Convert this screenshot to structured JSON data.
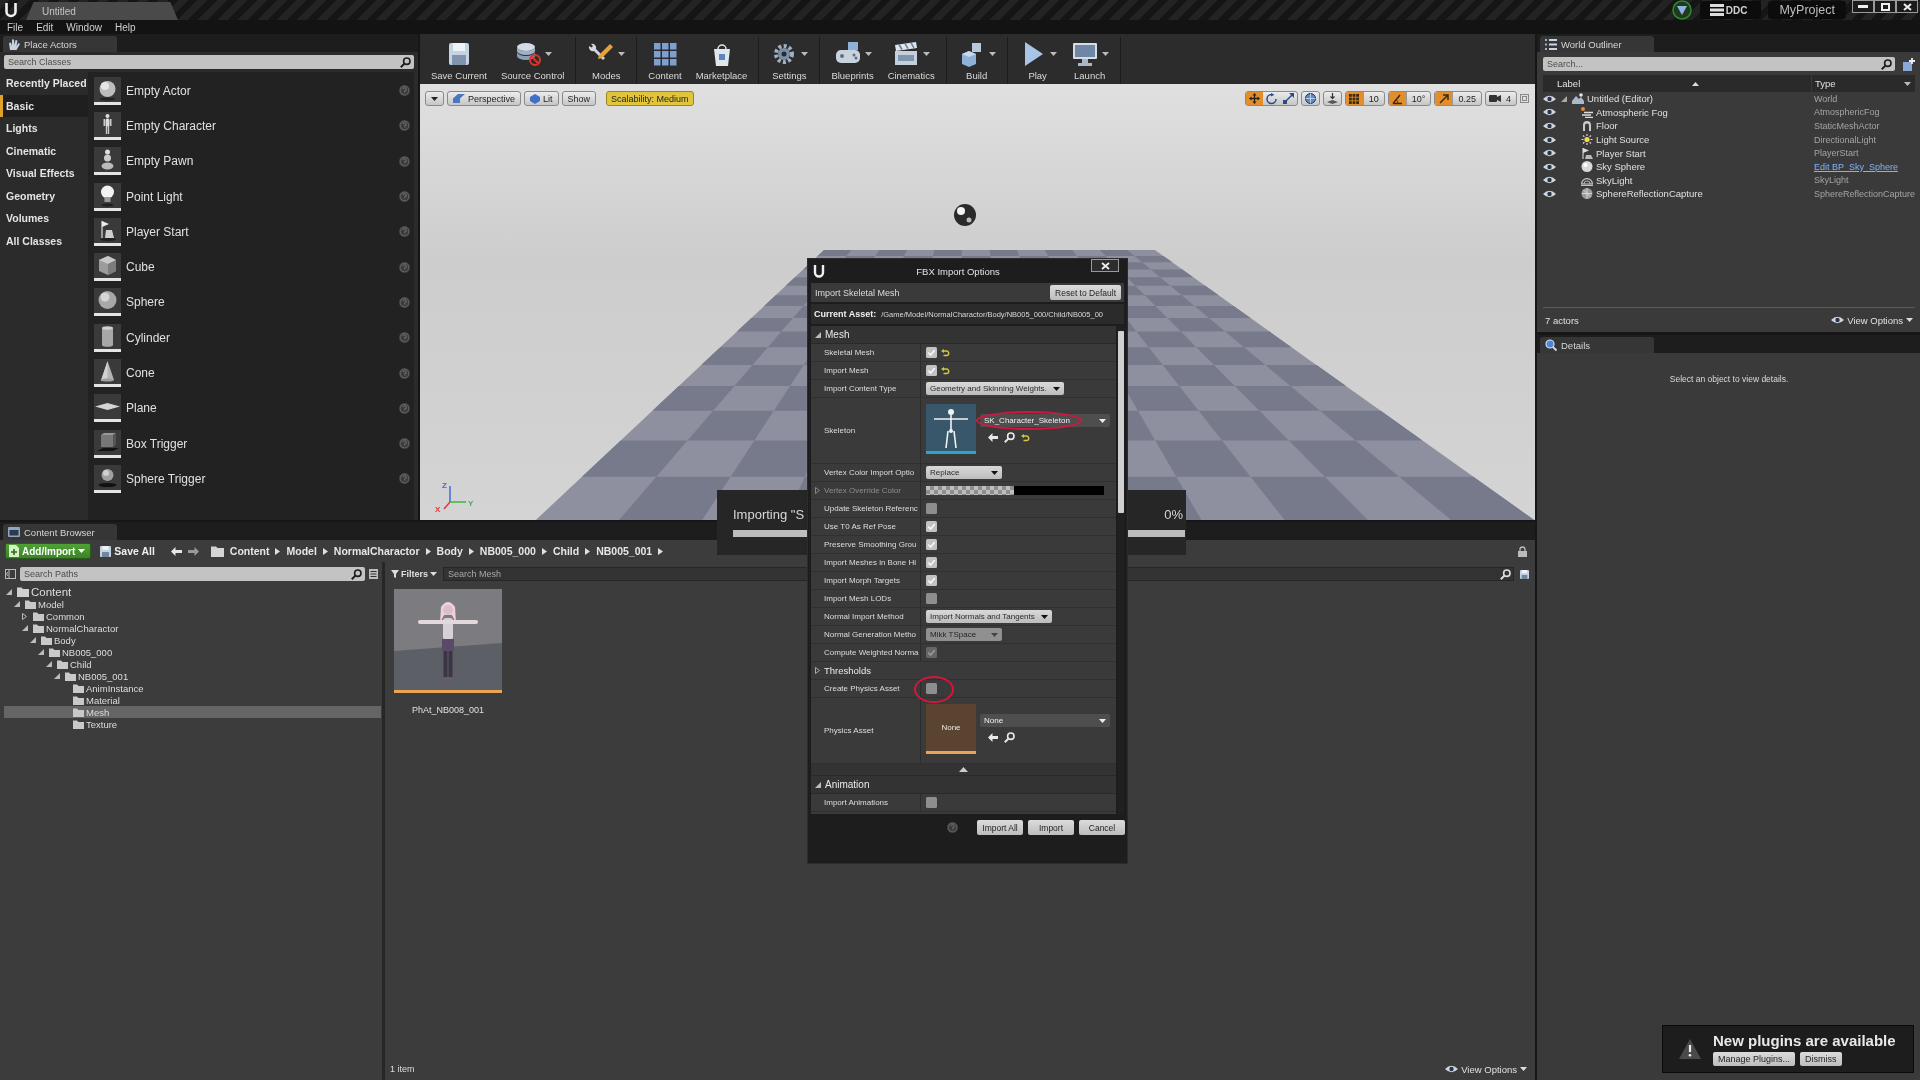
{
  "title_bar": {
    "tab": "Untitled",
    "ddc": "DDC",
    "project": "MyProject"
  },
  "menu": [
    "File",
    "Edit",
    "Window",
    "Help"
  ],
  "place_actors": {
    "tab": "Place Actors",
    "search_placeholder": "Search Classes",
    "categories": [
      {
        "label": "Recently Placed",
        "selected": false
      },
      {
        "label": "Basic",
        "selected": true
      },
      {
        "label": "Lights",
        "selected": false
      },
      {
        "label": "Cinematic",
        "selected": false
      },
      {
        "label": "Visual Effects",
        "selected": false
      },
      {
        "label": "Geometry",
        "selected": false
      },
      {
        "label": "Volumes",
        "selected": false
      },
      {
        "label": "All Classes",
        "selected": false
      }
    ],
    "items": [
      {
        "label": "Empty Actor",
        "kind": "actor"
      },
      {
        "label": "Empty Character",
        "kind": "character"
      },
      {
        "label": "Empty Pawn",
        "kind": "pawn"
      },
      {
        "label": "Point Light",
        "kind": "light"
      },
      {
        "label": "Player Start",
        "kind": "start"
      },
      {
        "label": "Cube",
        "kind": "cube"
      },
      {
        "label": "Sphere",
        "kind": "sphere"
      },
      {
        "label": "Cylinder",
        "kind": "cylinder"
      },
      {
        "label": "Cone",
        "kind": "cone"
      },
      {
        "label": "Plane",
        "kind": "plane"
      },
      {
        "label": "Box Trigger",
        "kind": "box_trigger"
      },
      {
        "label": "Sphere Trigger",
        "kind": "sphere_trigger"
      }
    ]
  },
  "toolbar_groups": [
    {
      "buttons": [
        {
          "label": "Save Current",
          "kind": "save",
          "menu": false
        },
        {
          "label": "Source Control",
          "kind": "source_control",
          "menu": true
        }
      ]
    },
    {
      "buttons": [
        {
          "label": "Modes",
          "kind": "modes",
          "menu": true
        }
      ]
    },
    {
      "buttons": [
        {
          "label": "Content",
          "kind": "content",
          "menu": false
        },
        {
          "label": "Marketplace",
          "kind": "marketplace",
          "menu": false
        }
      ]
    },
    {
      "buttons": [
        {
          "label": "Settings",
          "kind": "settings",
          "menu": true
        }
      ]
    },
    {
      "buttons": [
        {
          "label": "Blueprints",
          "kind": "blueprints",
          "menu": true
        },
        {
          "label": "Cinematics",
          "kind": "cinematics",
          "menu": true
        }
      ]
    },
    {
      "buttons": [
        {
          "label": "Build",
          "kind": "build",
          "menu": true
        }
      ]
    },
    {
      "buttons": [
        {
          "label": "Play",
          "kind": "play",
          "menu": true
        },
        {
          "label": "Launch",
          "kind": "launch",
          "menu": true
        }
      ]
    }
  ],
  "viewport": {
    "view_button": "Perspective",
    "lighting_button": "Lit",
    "show_button": "Show",
    "scalability": "Scalability: Medium",
    "transform_tools": [
      {
        "kind": "move",
        "selected": true
      },
      {
        "kind": "rotate",
        "selected": false
      },
      {
        "kind": "scale",
        "selected": false
      }
    ],
    "snaps": [
      {
        "kind": "grid",
        "value": "10",
        "on": true
      },
      {
        "kind": "rotation",
        "value": "10°",
        "on": true
      },
      {
        "kind": "scale",
        "value": "0.25",
        "on": true
      }
    ],
    "camera_speed": "4",
    "axes": [
      {
        "label": "Z",
        "color": "#3d6be0"
      },
      {
        "label": "X",
        "color": "#e03a3a"
      },
      {
        "label": "Y",
        "color": "#3ab83a"
      }
    ]
  },
  "import_progress": {
    "message": "Importing \"S",
    "percent": "0%",
    "level": 0
  },
  "import_dialog": {
    "title": "FBX Import Options",
    "subtitle": "Import Skeletal Mesh",
    "reset_button": "Reset to Default",
    "asset_label": "Current Asset:",
    "asset_path": "/Game/Model/NormalCharactor/Body/NB005_000/Child/NB005_00",
    "sections": [
      {
        "title": "Mesh",
        "expanded": true,
        "rows": [
          {
            "kind": "checkbox",
            "label": "Skeletal Mesh",
            "checked": true,
            "disabled": false,
            "modified": true,
            "annotated": false
          },
          {
            "kind": "checkbox",
            "label": "Import Mesh",
            "checked": true,
            "disabled": false,
            "modified": true,
            "annotated": false
          },
          {
            "kind": "dropdown",
            "label": "Import Content Type",
            "value": "Geometry and Skinning Weights.",
            "disabled": false,
            "modified": false,
            "annotated": false
          },
          {
            "kind": "asset",
            "label": "Skeleton",
            "value": "SK_Character_Skeleton",
            "modified": true,
            "annotated": true
          },
          {
            "kind": "dropdown",
            "label": "Vertex Color Import Optio",
            "value": "Replace",
            "disabled": false,
            "modified": false,
            "annotated": false
          },
          {
            "kind": "color",
            "label": "Vertex Override Color",
            "expanded": false,
            "disabled": true,
            "annotated": false
          },
          {
            "kind": "checkbox",
            "label": "Update Skeleton Referenc",
            "checked": false,
            "disabled": false,
            "modified": false,
            "annotated": false
          },
          {
            "kind": "checkbox",
            "label": "Use T0 As Ref Pose",
            "checked": true,
            "disabled": false,
            "modified": false,
            "annotated": false
          },
          {
            "kind": "checkbox",
            "label": "Preserve Smoothing Grou",
            "checked": true,
            "disabled": false,
            "modified": false,
            "annotated": false
          },
          {
            "kind": "checkbox",
            "label": "Import Meshes in Bone Hi",
            "checked": true,
            "disabled": false,
            "modified": false,
            "annotated": false
          },
          {
            "kind": "checkbox",
            "label": "Import Morph Targets",
            "checked": true,
            "disabled": false,
            "modified": false,
            "annotated": false
          },
          {
            "kind": "checkbox",
            "label": "Import Mesh LODs",
            "checked": false,
            "disabled": false,
            "modified": false,
            "annotated": false
          },
          {
            "kind": "dropdown",
            "label": "Normal Import Method",
            "value": "Import Normals and Tangents",
            "disabled": false,
            "modified": false,
            "annotated": false
          },
          {
            "kind": "dropdown",
            "label": "Normal Generation Metho",
            "value": "Mikk TSpace",
            "disabled": true,
            "modified": false,
            "annotated": false
          },
          {
            "kind": "checkbox",
            "label": "Compute Weighted Norma",
            "checked": true,
            "disabled": true,
            "modified": false,
            "annotated": false
          },
          {
            "kind": "group",
            "label": "Thresholds",
            "expanded": false
          },
          {
            "kind": "checkbox",
            "label": "Create Physics Asset",
            "checked": false,
            "disabled": false,
            "modified": false,
            "annotated": true
          },
          {
            "kind": "asset",
            "label": "Physics Asset",
            "value": "None",
            "thumbnail_text": "None",
            "modified": false,
            "annotated": false
          },
          {
            "kind": "advanced",
            "expanded": true
          }
        ]
      },
      {
        "title": "Animation",
        "expanded": true,
        "rows": [
          {
            "kind": "checkbox",
            "label": "Import Animations",
            "checked": false,
            "disabled": false,
            "modified": false,
            "annotated": false
          }
        ]
      }
    ],
    "buttons": [
      "Import All",
      "Import",
      "Cancel"
    ]
  },
  "world_outliner": {
    "tab": "World Outliner",
    "search_placeholder": "Search...",
    "columns": [
      "Label",
      "Type"
    ],
    "actors": [
      {
        "label": "Untitled (Editor)",
        "type": "World",
        "kind": "world",
        "visible": true,
        "expanded": true,
        "type_link": false,
        "children": [
          {
            "label": "Atmospheric Fog",
            "type": "AtmosphericFog",
            "kind": "fog",
            "visible": true,
            "type_link": false
          },
          {
            "label": "Floor",
            "type": "StaticMeshActor",
            "kind": "mesh",
            "visible": true,
            "type_link": false
          },
          {
            "label": "Light Source",
            "type": "DirectionalLight",
            "kind": "sun",
            "visible": true,
            "type_link": false
          },
          {
            "label": "Player Start",
            "type": "PlayerStart",
            "kind": "start",
            "visible": true,
            "type_link": false
          },
          {
            "label": "Sky Sphere",
            "type": "Edit BP_Sky_Sphere",
            "kind": "sphere",
            "visible": true,
            "type_link": true
          },
          {
            "label": "SkyLight",
            "type": "SkyLight",
            "kind": "skylight",
            "visible": true,
            "type_link": false
          },
          {
            "label": "SphereReflectionCapture",
            "type": "SphereReflectionCapture",
            "kind": "capture",
            "visible": true,
            "type_link": false
          }
        ]
      }
    ],
    "count": "7 actors",
    "view_options": "View Options"
  },
  "details": {
    "tab": "Details",
    "message": "Select an object to view details."
  },
  "content_browser": {
    "tab": "Content Browser",
    "add_button": "Add/Import",
    "save_all": "Save All",
    "breadcrumb": [
      "Content",
      "Model",
      "NormalCharactor",
      "Body",
      "NB005_000",
      "Child",
      "NB005_001"
    ],
    "path_search_placeholder": "Search Paths",
    "filters": "Filters",
    "asset_search_placeholder": "Search Mesh",
    "folders": [
      {
        "label": "Content",
        "selected": false,
        "expanded": true,
        "children": [
          {
            "label": "Model",
            "selected": false,
            "expanded": true,
            "children": [
              {
                "label": "Common",
                "selected": false,
                "expanded": false
              },
              {
                "label": "NormalCharactor",
                "selected": false,
                "expanded": true,
                "children": [
                  {
                    "label": "Body",
                    "selected": false,
                    "expanded": true,
                    "children": [
                      {
                        "label": "NB005_000",
                        "selected": false,
                        "expanded": true,
                        "children": [
                          {
                            "label": "Child",
                            "selected": false,
                            "expanded": true,
                            "children": [
                              {
                                "label": "NB005_001",
                                "selected": false,
                                "expanded": true,
                                "children": [
                                  {
                                    "label": "AnimInstance",
                                    "selected": false
                                  },
                                  {
                                    "label": "Material",
                                    "selected": false
                                  },
                                  {
                                    "label": "Mesh",
                                    "selected": true
                                  },
                                  {
                                    "label": "Texture",
                                    "selected": false
                                  }
                                ]
                              }
                            ]
                          }
                        ]
                      }
                    ]
                  }
                ]
              }
            ]
          }
        ]
      }
    ],
    "assets": [
      {
        "label": "PhAt_NB008_001"
      }
    ],
    "item_count": "1 item",
    "view_options": "View Options"
  },
  "notification": {
    "message": "New plugins are available",
    "buttons": [
      "Manage Plugins...",
      "Dismiss"
    ]
  }
}
